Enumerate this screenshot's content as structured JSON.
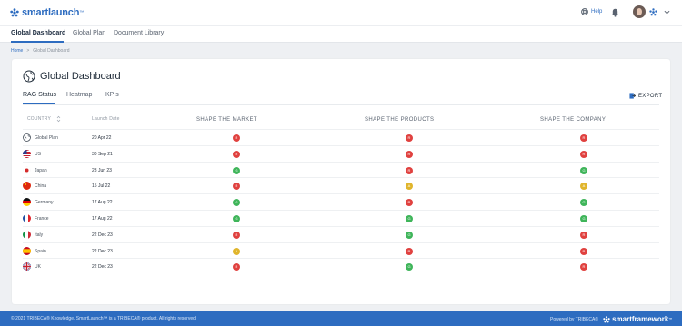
{
  "app": {
    "logo_text": "smartlaunch",
    "logo_tm": "™",
    "help_label": "Help"
  },
  "nav": {
    "items": [
      {
        "label": "Global Dashboard",
        "active": true
      },
      {
        "label": "Global Plan",
        "active": false
      },
      {
        "label": "Document Library",
        "active": false
      }
    ]
  },
  "breadcrumb": {
    "home": "Home",
    "separator": ">",
    "current": "Global Dashboard"
  },
  "page": {
    "title": "Global Dashboard",
    "tabs": [
      {
        "label": "RAG Status",
        "active": true
      },
      {
        "label": "Heatmap",
        "active": false
      },
      {
        "label": "KPIs",
        "active": false
      }
    ],
    "export_label": "EXPORT"
  },
  "table": {
    "col_country": "COUNTRY",
    "col_launch": "Launch Date",
    "col_market": "SHAPE THE MARKET",
    "col_products": "SHAPE THE PRODUCTS",
    "col_company": "SHAPE THE COMPANY",
    "rows": [
      {
        "flag": "globe",
        "country": "Global Plan",
        "date": "20 Apr 22",
        "status": [
          "R",
          "R",
          "R"
        ]
      },
      {
        "flag": "us",
        "country": "US",
        "date": "30 Sep 21",
        "status": [
          "R",
          "R",
          "R"
        ]
      },
      {
        "flag": "japan",
        "country": "Japan",
        "date": "23 Jun 23",
        "status": [
          "G",
          "R",
          "G"
        ]
      },
      {
        "flag": "china",
        "country": "China",
        "date": "15 Jul 22",
        "status": [
          "R",
          "A",
          "A"
        ]
      },
      {
        "flag": "germany",
        "country": "Germany",
        "date": "17 Aug 22",
        "status": [
          "G",
          "R",
          "G"
        ]
      },
      {
        "flag": "france",
        "country": "France",
        "date": "17 Aug 22",
        "status": [
          "G",
          "G",
          "G"
        ]
      },
      {
        "flag": "italy",
        "country": "Italy",
        "date": "22 Dec 23",
        "status": [
          "R",
          "G",
          "R"
        ]
      },
      {
        "flag": "spain",
        "country": "Spain",
        "date": "22 Dec 23",
        "status": [
          "A",
          "R",
          "R"
        ]
      },
      {
        "flag": "uk",
        "country": "UK",
        "date": "22 Dec 23",
        "status": [
          "R",
          "G",
          "R"
        ]
      }
    ]
  },
  "status_colors": {
    "R": "#e0413f",
    "A": "#e0b52c",
    "G": "#3fb55a"
  },
  "footer": {
    "copyright": "© 2021 TRIBECA® Knowledge. SmartLaunch™ is a TRIBECA® product. All rights reserved.",
    "powered_by": "Powered by TRIBECA®",
    "brand": "smartframework",
    "brand_tm": "™"
  },
  "icons": {
    "logo": "smartlaunch-logo-icon",
    "help": "help-icon",
    "notifications": "bell-icon",
    "star": "star-icon",
    "chevron": "chevron-down-icon",
    "globe": "globe-icon",
    "export": "export-icon",
    "sort": "sort-icon"
  }
}
